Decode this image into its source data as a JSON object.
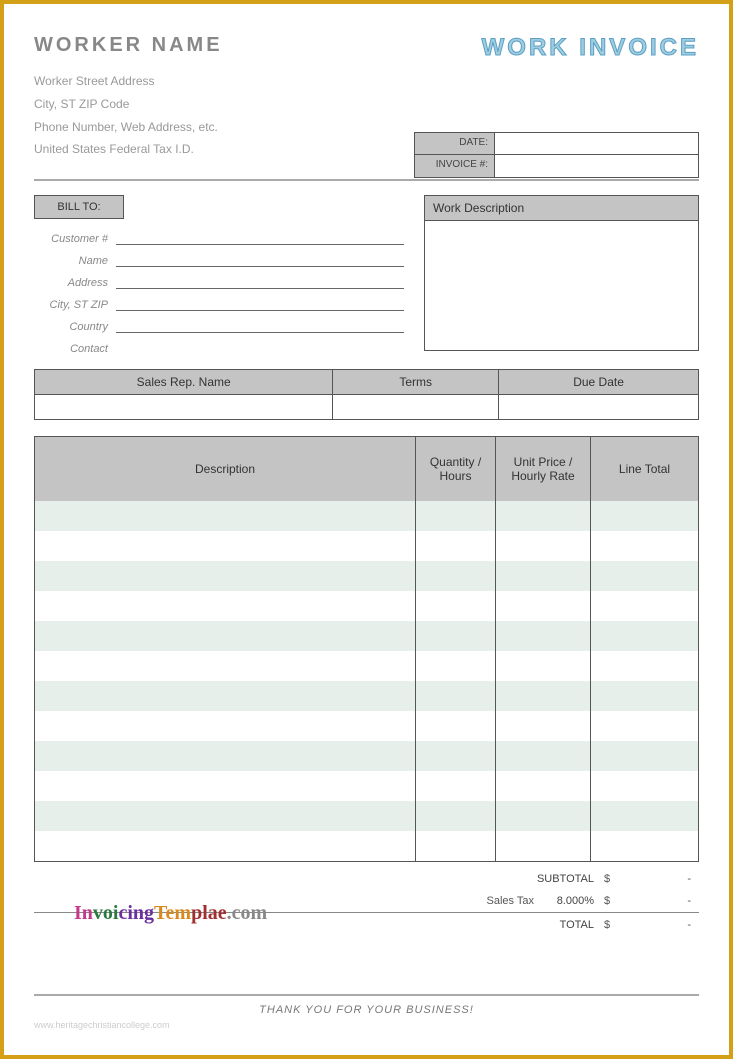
{
  "header": {
    "worker_name": "WORKER NAME",
    "title": "WORK INVOICE",
    "address": {
      "street": "Worker Street Address",
      "city_st_zip": "City, ST  ZIP Code",
      "phone_web": "Phone Number, Web Address, etc.",
      "tax_id": "United States Federal Tax I.D."
    }
  },
  "meta": {
    "date_label": "DATE:",
    "invoice_label": "INVOICE #:",
    "date_value": "",
    "invoice_value": ""
  },
  "billto": {
    "header": "BILL TO:",
    "labels": {
      "customer_no": "Customer #",
      "name": "Name",
      "address": "Address",
      "city_st_zip": "City, ST ZIP",
      "country": "Country",
      "contact": "Contact"
    }
  },
  "workdesc": {
    "header": "Work Description",
    "body": ""
  },
  "sales": {
    "cols": [
      "Sales Rep. Name",
      "Terms",
      "Due Date"
    ],
    "vals": [
      "",
      "",
      ""
    ]
  },
  "items": {
    "headers": {
      "description": "Description",
      "qty": "Quantity / Hours",
      "rate": "Unit Price / Hourly Rate",
      "total": "Line Total"
    },
    "row_count": 12
  },
  "totals": {
    "subtotal_label": "SUBTOTAL",
    "sales_tax_label": "Sales Tax",
    "sales_tax_rate": "8.000%",
    "total_label": "TOTAL",
    "currency": "$",
    "dash": "-"
  },
  "footer": {
    "thankyou": "THANK YOU FOR YOUR BUSINESS!",
    "fineprint": "www.heritagechristiancollege.com",
    "logo_text": "InvoicingTemplae.com"
  }
}
